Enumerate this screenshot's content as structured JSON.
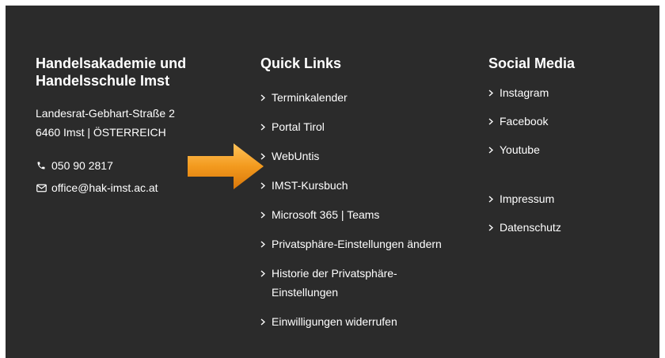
{
  "school": {
    "title_line1": "Handelsakademie und",
    "title_line2": "Handelsschule Imst",
    "address_line1": "Landesrat-Gebhart-Straße 2",
    "address_line2": "6460 Imst | ÖSTERREICH",
    "phone": "050 90 2817",
    "email": "office@hak-imst.ac.at",
    "phone_icon": "phone-icon",
    "email_icon": "mail-icon"
  },
  "quick_links": {
    "heading": "Quick Links",
    "items": [
      {
        "label": "Terminkalender"
      },
      {
        "label": "Portal Tirol"
      },
      {
        "label": "WebUntis"
      },
      {
        "label": "IMST-Kursbuch"
      },
      {
        "label": "Microsoft 365 | Teams"
      },
      {
        "label": "Privatsphäre-Einstellungen ändern"
      },
      {
        "label_line1": "Historie der Privatsphäre-",
        "label_line2": "Einstellungen"
      },
      {
        "label": "Einwilligungen widerrufen"
      }
    ]
  },
  "social_media": {
    "heading": "Social Media",
    "items": [
      {
        "label": "Instagram"
      },
      {
        "label": "Facebook"
      },
      {
        "label": "Youtube"
      }
    ]
  },
  "legal": {
    "items": [
      {
        "label": "Impressum"
      },
      {
        "label": "Datenschutz"
      }
    ]
  },
  "colors": {
    "background": "#2b2b2b",
    "text": "#ffffff",
    "arrow_fill": "#f39a1e"
  },
  "annotation": {
    "icon": "arrow-right-icon"
  }
}
